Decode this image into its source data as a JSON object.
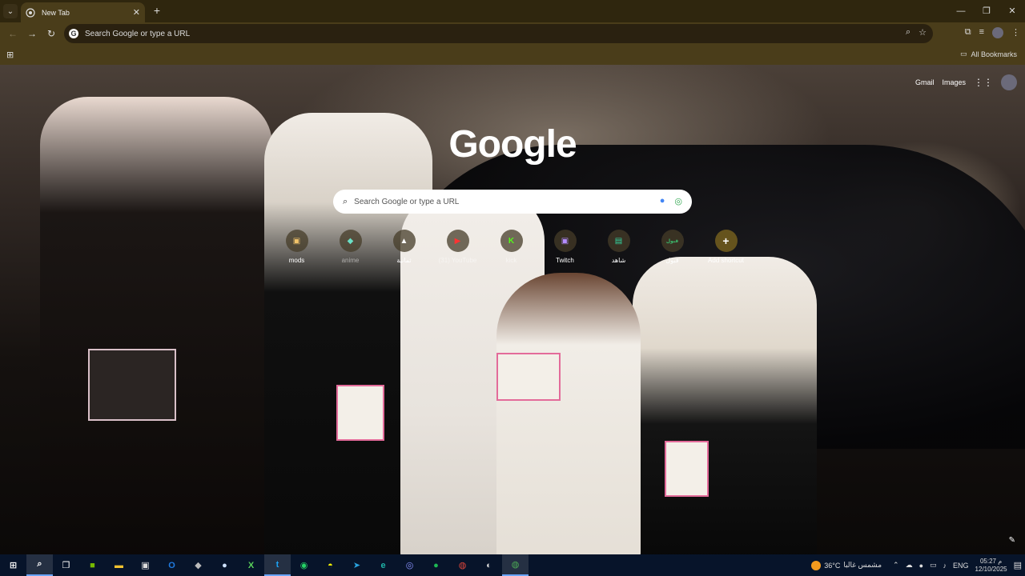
{
  "browser": {
    "tab_title": "New Tab",
    "new_tab_symbol": "+",
    "close_symbol": "✕",
    "window_controls": [
      "—",
      "❐",
      "✕"
    ],
    "omnibox_placeholder": "Search Google or type a URL",
    "bookmarks_all": "All Bookmarks"
  },
  "ntp": {
    "links": {
      "gmail": "Gmail",
      "images": "Images"
    },
    "logo": "Google",
    "search_placeholder": "Search Google or type a URL",
    "shortcuts": [
      {
        "label": "mods",
        "icon": "mods-icon",
        "glyph": "▣"
      },
      {
        "label": "anime",
        "icon": "anime-icon",
        "glyph": "◆"
      },
      {
        "label": "ثمانية",
        "icon": "thamaniya-icon",
        "glyph": "▲"
      },
      {
        "label": "(31) YouTube",
        "icon": "youtube-icon",
        "glyph": "▶"
      },
      {
        "label": "kick",
        "icon": "kick-icon",
        "glyph": "K"
      },
      {
        "label": "Twitch",
        "icon": "twitch-icon",
        "glyph": "▣"
      },
      {
        "label": "شاهد",
        "icon": "shahid-icon",
        "glyph": "▤"
      },
      {
        "label": "قبول",
        "icon": "qaboul-icon",
        "glyph": "قبول"
      },
      {
        "label": "Add shortcut",
        "icon": "add-icon",
        "glyph": "+"
      }
    ]
  },
  "taskbar": {
    "weather": {
      "temp": "36°C",
      "condition": "مشمس غالبا"
    },
    "language": "ENG",
    "time": "05:27 م",
    "date": "12/10/2025",
    "icons": [
      "start-icon",
      "search-icon",
      "task-view-icon",
      "nvidia-icon",
      "file-explorer-icon",
      "store-icon",
      "outlook-icon",
      "epic-icon",
      "steam-icon",
      "xbox-icon",
      "twitter-icon",
      "whatsapp-icon",
      "snapchat-icon",
      "telegram-icon",
      "edge-icon",
      "discord-icon",
      "spotify-icon",
      "chrome-icon",
      "github-icon",
      "chrome-dev-icon"
    ]
  },
  "colors": {
    "titlebar": "#2f260e",
    "toolbar": "#4a3d1a",
    "taskbar": "#07142a"
  }
}
